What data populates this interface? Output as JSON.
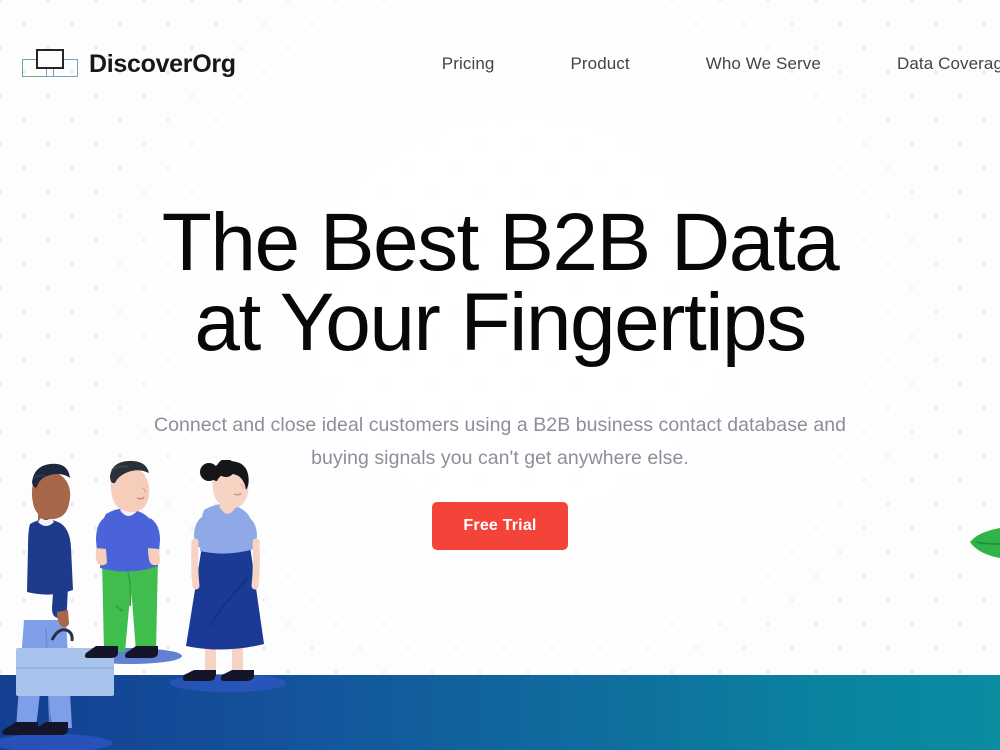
{
  "header": {
    "brand_name": "DiscoverOrg",
    "logo_icon": "discoverorg-overlapping-rectangles-logo",
    "logo_colors": {
      "green": "#6aab8e",
      "blue": "#7d9fc4",
      "dark": "#22262b"
    },
    "nav": [
      {
        "label": "Pricing",
        "name": "nav-item-pricing"
      },
      {
        "label": "Product",
        "name": "nav-item-product"
      },
      {
        "label": "Who We Serve",
        "name": "nav-item-who-we-serve"
      },
      {
        "label": "Data Coverage",
        "name": "nav-item-data-coverage"
      }
    ]
  },
  "hero": {
    "headline_line1": "The Best B2B Data",
    "headline_line2": "at Your Fingertips",
    "subhead_line1": "Connect and close ideal customers using a B2B business contact",
    "subhead_line2": "database and buying signals you can't get anywhere else.",
    "cta_label": "Free Trial",
    "cta_color": "#f4443a",
    "headline_color": "#07080a",
    "subhead_color": "#8a8f99"
  },
  "illustration": {
    "name": "three-people-standing-illustration",
    "floor_gradient_from": "#143f91",
    "floor_gradient_to": "#0a8ca1",
    "people": [
      {
        "name": "person-left-with-briefcase",
        "shirt": "#1e3a8a",
        "pants": "#7f9ee8",
        "skin": "#a8674a",
        "hair": "#1d2740",
        "accessory": "briefcase"
      },
      {
        "name": "person-center-green-pants",
        "shirt": "#4a63d8",
        "pants": "#3fbe4e",
        "skin": "#f6cdbb",
        "hair": "#2b2f38",
        "accessory": "none"
      },
      {
        "name": "person-right-with-skirt",
        "shirt": "#8fa9e8",
        "pants": "#1b3a96",
        "skin": "#f7d3c4",
        "hair": "#15151a",
        "accessory": "bun-hair"
      }
    ],
    "edge_leaf_color": "#2fb34a"
  },
  "background": {
    "page_color": "#fdfdfd",
    "dot_color": "#cfd4dd"
  }
}
